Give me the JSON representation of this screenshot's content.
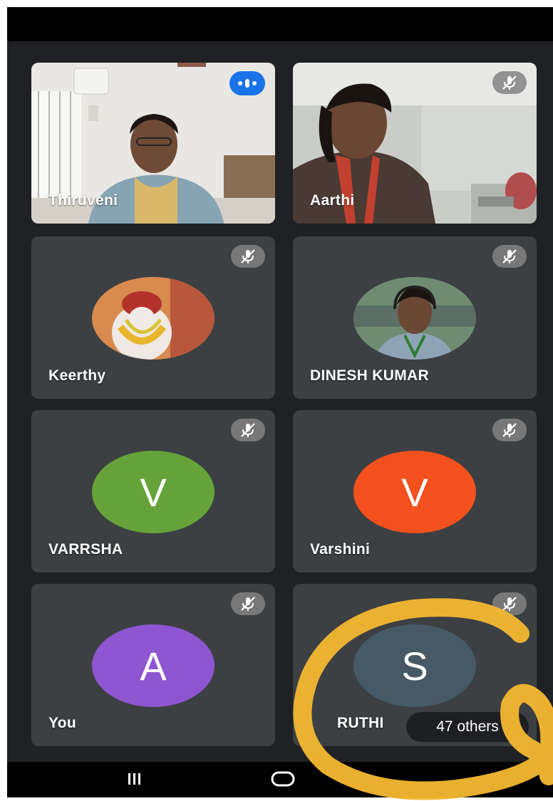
{
  "participants": [
    {
      "name": "Thiruveni",
      "state": "speaking",
      "media": "video",
      "icon": "speaking-indicator-icon"
    },
    {
      "name": "Aarthi",
      "state": "muted",
      "media": "video",
      "icon": "mic-off-icon"
    },
    {
      "name": "Keerthy",
      "state": "muted",
      "media": "photo",
      "icon": "mic-off-icon"
    },
    {
      "name": "DINESH KUMAR",
      "state": "muted",
      "media": "photo",
      "icon": "mic-off-icon"
    },
    {
      "name": "VARRSHA",
      "state": "muted",
      "media": "initial",
      "initial": "V",
      "avatar_color": "#65a33a",
      "icon": "mic-off-icon"
    },
    {
      "name": "Varshini",
      "state": "muted",
      "media": "initial",
      "initial": "V",
      "avatar_color": "#f4511e",
      "icon": "mic-off-icon"
    },
    {
      "name": "You",
      "state": "muted",
      "media": "initial",
      "initial": "A",
      "avatar_color": "#8e56d0",
      "icon": "mic-off-icon"
    },
    {
      "name": "RUTHI",
      "state": "muted",
      "media": "initial",
      "initial": "S",
      "avatar_color": "#455a64",
      "icon": "mic-off-icon"
    }
  ],
  "others_label": "47 others",
  "colors": {
    "background": "#202124",
    "tile": "#3c4043",
    "speaking": "#1a73e8",
    "annotation": "#f2b630"
  },
  "navbar": {
    "icons": [
      "recent-apps-icon",
      "home-icon"
    ]
  }
}
